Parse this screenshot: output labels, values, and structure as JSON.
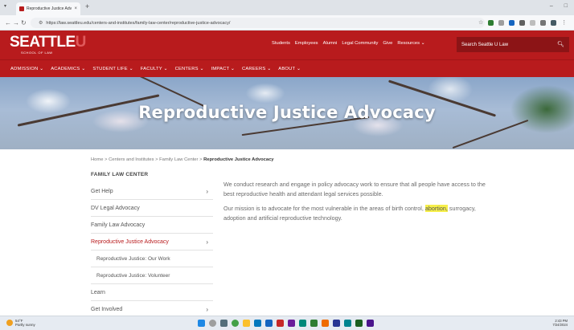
{
  "browser": {
    "tab_title": "Reproductive Justice Advocacy",
    "tab_close": "×",
    "new_tab": "+",
    "url": "https://law.seattleu.edu/centers-and-institutes/family-law-center/reproductive-justice-advocacy/",
    "window_controls": [
      "–",
      "□"
    ]
  },
  "header": {
    "logo_main": "SEATTLE",
    "logo_suffix": "U",
    "logo_sub": "SCHOOL OF LAW",
    "top_links": [
      "Students",
      "Employees",
      "Alumni",
      "Legal Community",
      "Give",
      "Resources ⌄"
    ],
    "search_label": "Search Seattle U Law",
    "search_icon": "search-icon"
  },
  "main_nav": [
    "ADMISSION ⌄",
    "ACADEMICS ⌄",
    "STUDENT LIFE ⌄",
    "FACULTY ⌄",
    "CENTERS ⌄",
    "IMPACT ⌄",
    "CAREERS ⌄",
    "ABOUT ⌄"
  ],
  "hero": {
    "title": "Reproductive Justice Advocacy"
  },
  "breadcrumb": {
    "home": "Home",
    "centers": "Centers and Institutes",
    "flc": "Family Law Center",
    "current": "Reproductive Justice Advocacy",
    "sep": ">"
  },
  "sidebar": {
    "heading": "FAMILY LAW CENTER",
    "items": [
      {
        "label": "Get Help",
        "chevron": "›"
      },
      {
        "label": "DV Legal Advocacy",
        "chevron": ""
      },
      {
        "label": "Family Law Advocacy",
        "chevron": ""
      },
      {
        "label": "Reproductive Justice Advocacy",
        "chevron": "›"
      },
      {
        "label": "Reproductive Justice: Our Work",
        "chevron": ""
      },
      {
        "label": "Reproductive Justice: Volunteer",
        "chevron": ""
      },
      {
        "label": "Learn",
        "chevron": ""
      },
      {
        "label": "Get Involved",
        "chevron": "›"
      }
    ]
  },
  "content": {
    "para1": "We conduct research and engage in policy advocacy work to ensure that all people have access to the best reproductive health and attendant legal services possible.",
    "para2_before": "Our mission is to advocate for the most vulnerable in the areas of birth control, ",
    "para2_highlight": "abortion,",
    "para2_after": " surrogacy, adoption and artificial reproductive technology."
  },
  "taskbar": {
    "weather_temp": "54°F",
    "weather_desc": "Partly sunny",
    "time": "2:43 PM",
    "date": "7/24/2024"
  },
  "colors": {
    "brand_red": "#b81b1d",
    "highlight": "#f6ef4a"
  }
}
